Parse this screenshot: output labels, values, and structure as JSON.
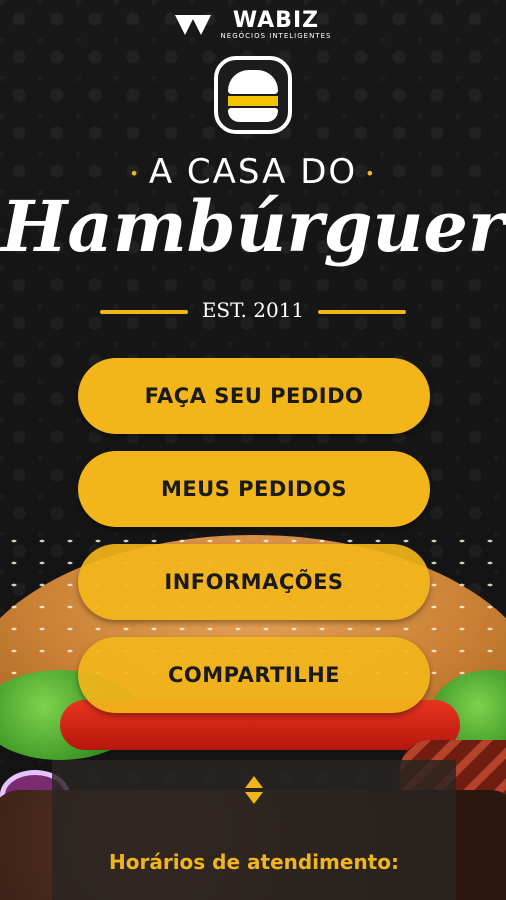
{
  "brand": {
    "name": "WABIZ",
    "tagline": "NEGÓCIOS INTELIGENTES"
  },
  "logo": {
    "line1": "A CASA DO",
    "line2": "Hambúrguer",
    "est": "EST. 2011"
  },
  "menu": {
    "order_label": "FAÇA SEU PEDIDO",
    "my_orders_label": "MEUS PEDIDOS",
    "info_label": "INFORMAÇÕES",
    "share_label": "COMPARTILHE"
  },
  "panel": {
    "hours_title": "Horários de atendimento:"
  },
  "colors": {
    "accent": "#f2b51a",
    "background": "#1c1c1c"
  },
  "icons": [
    "wabiz-logo-icon",
    "burger-badge-icon",
    "expand-arrows-icon"
  ]
}
